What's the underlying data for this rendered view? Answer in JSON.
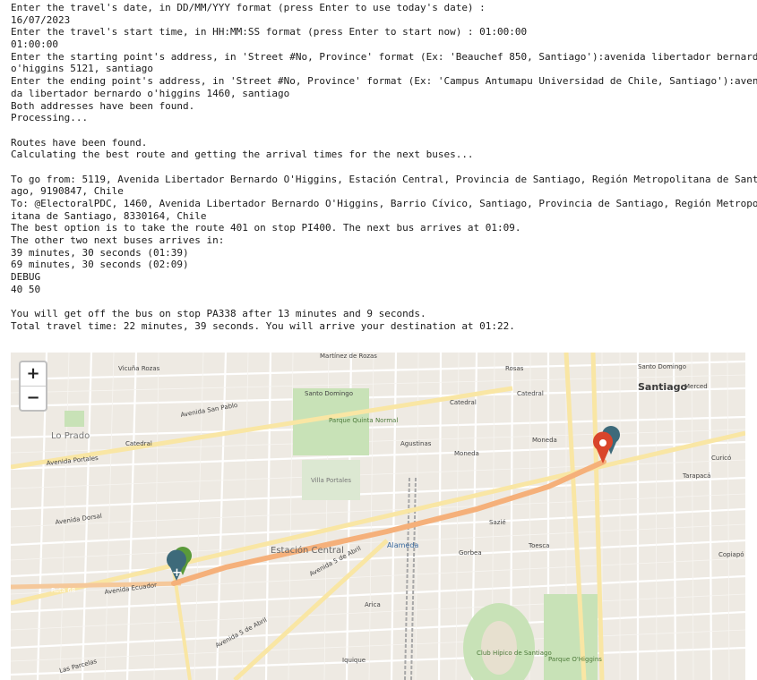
{
  "console_lines": [
    "Enter the travel's date, in DD/MM/YYY format (press Enter to use today's date) :",
    "16/07/2023",
    "Enter the travel's start time, in HH:MM:SS format (press Enter to start now) : 01:00:00",
    "01:00:00",
    "Enter the starting point's address, in 'Street #No, Province' format (Ex: 'Beauchef 850, Santiago'):avenida libertador bernardo",
    "o'higgins 5121, santiago",
    "Enter the ending point's address, in 'Street #No, Province' format (Ex: 'Campus Antumapu Universidad de Chile, Santiago'):aveni",
    "da libertador bernardo o'higgins 1460, santiago",
    "Both addresses have been found.",
    "Processing...",
    "",
    "Routes have been found.",
    "Calculating the best route and getting the arrival times for the next buses...",
    "",
    "To go from: 5119, Avenida Libertador Bernardo O'Higgins, Estación Central, Provincia de Santiago, Región Metropolitana de Santi",
    "ago, 9190847, Chile",
    "To: @ElectoralPDC, 1460, Avenida Libertador Bernardo O'Higgins, Barrio Cívico, Santiago, Provincia de Santiago, Región Metropol",
    "itana de Santiago, 8330164, Chile",
    "The best option is to take the route 401 on stop PI400. The next bus arrives at 01:09.",
    "The other two next buses arrives in:",
    "39 minutes, 30 seconds (01:39)",
    "69 minutes, 30 seconds (02:09)",
    "DEBUG",
    "40 50",
    "",
    "You will get off the bus on stop PA338 after 13 minutes and 9 seconds.",
    "Total travel time: 22 minutes, 39 seconds. You will arrive your destination at 01:22."
  ],
  "map": {
    "zoom_in": "+",
    "zoom_out": "−",
    "route_color": "#f5b87a",
    "start_marker_color": "#3d6a7a",
    "end_marker_color": "#d9452b",
    "labels": {
      "santiago": "Santiago",
      "estacion_central": "Estación Central",
      "lo_prado": "Lo Prado",
      "alameda": "Alameda",
      "parque_quinta_normal": "Parque Quinta Normal",
      "villa_portales": "Villa Portales",
      "club_hipico": "Club Hípico de Santiago",
      "parque_ohiggins": "Parque O'Higgins",
      "vicuna_rozas": "Vicuña Rozas",
      "martinez_de_rozas": "Martínez de Rozas",
      "santo_domingo": "Santo Domingo",
      "santo_domingo_e": "Santo Domingo",
      "merced": "Merced",
      "catedral_w": "Catedral",
      "catedral_e": "Catedral",
      "catedral_ne": "Catedral",
      "moneda": "Moneda",
      "moneda_e": "Moneda",
      "agustinas": "Agustinas",
      "avenida_san_pablo": "Avenida San Pablo",
      "avenida_ecuador": "Avenida Ecuador",
      "avenida_5_de_abril": "Avenida 5 de Abril",
      "ruta_68": "Ruta 68",
      "avenida_portales": "Avenida Portales",
      "avenida_dorsal": "Avenida Dorsal",
      "arica": "Arica",
      "iquique": "Iquique",
      "las_parcelas": "Las Parcelas",
      "sazie": "Sazié",
      "gorbea": "Gorbea",
      "toesca": "Toesca",
      "tarapaca": "Tarapacá",
      "curico": "Curicó",
      "copiapo": "Copiapó",
      "rosas": "Rosas"
    }
  }
}
